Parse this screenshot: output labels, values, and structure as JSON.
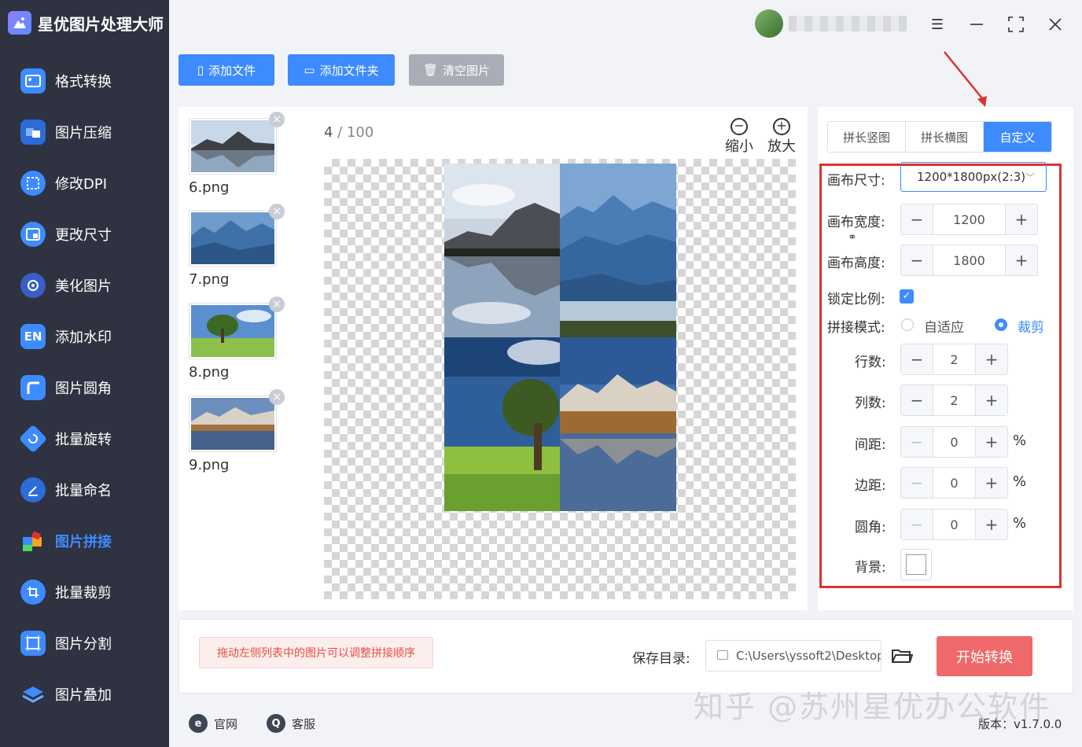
{
  "app": {
    "title": "星优图片处理大师"
  },
  "sidebar": {
    "items": [
      {
        "label": "格式转换",
        "icon": "image-convert-icon"
      },
      {
        "label": "图片压缩",
        "icon": "compress-icon"
      },
      {
        "label": "修改DPI",
        "icon": "dpi-icon"
      },
      {
        "label": "更改尺寸",
        "icon": "resize-icon"
      },
      {
        "label": "美化图片",
        "icon": "beautify-icon"
      },
      {
        "label": "添加水印",
        "icon": "watermark-icon"
      },
      {
        "label": "图片圆角",
        "icon": "round-corner-icon"
      },
      {
        "label": "批量旋转",
        "icon": "rotate-icon"
      },
      {
        "label": "批量命名",
        "icon": "rename-icon"
      },
      {
        "label": "图片拼接",
        "icon": "puzzle-icon",
        "active": true
      },
      {
        "label": "批量裁剪",
        "icon": "crop-icon"
      },
      {
        "label": "图片分割",
        "icon": "split-icon"
      },
      {
        "label": "图片叠加",
        "icon": "layers-icon"
      }
    ]
  },
  "toolbar": {
    "add_file": "添加文件",
    "add_folder": "添加文件夹",
    "clear": "清空图片"
  },
  "files": [
    {
      "name": "6.png"
    },
    {
      "name": "7.png"
    },
    {
      "name": "8.png"
    },
    {
      "name": "9.png"
    }
  ],
  "preview": {
    "current": "4",
    "sep": " / ",
    "total": "100",
    "zoom_out": "缩小",
    "zoom_in": "放大"
  },
  "modes": {
    "vertical": "拼长竖图",
    "horizontal": "拼长横图",
    "custom": "自定义"
  },
  "settings": {
    "canvas_size_label": "画布尺寸:",
    "canvas_size_value": "1200*1800px(2:3)",
    "canvas_width_label": "画布宽度:",
    "canvas_width": "1200",
    "canvas_height_label": "画布高度:",
    "canvas_height": "1800",
    "lock_ratio_label": "锁定比例:",
    "stitch_mode_label": "拼接模式:",
    "mode_fit": "自适应",
    "mode_crop": "裁剪",
    "rows_label": "行数:",
    "rows": "2",
    "cols_label": "列数:",
    "cols": "2",
    "spacing_label": "间距:",
    "spacing": "0",
    "margin_label": "边距:",
    "margin": "0",
    "radius_label": "圆角:",
    "radius": "0",
    "percent": "%",
    "bg_label": "背景:"
  },
  "bottom": {
    "hint": "拖动左侧列表中的图片可以调整拼接顺序",
    "save_label": "保存目录:",
    "save_path": "C:\\Users\\yssoft2\\Desktop",
    "start": "开始转换"
  },
  "footer": {
    "website": "官网",
    "support": "客服",
    "version": "版本：v1.7.0.0"
  },
  "watermark": "知乎 @苏州星优办公软件",
  "colors": {
    "accent": "#3d8bff",
    "sidebar": "#2f3240",
    "start": "#f0696a",
    "highlight": "#e03131"
  }
}
